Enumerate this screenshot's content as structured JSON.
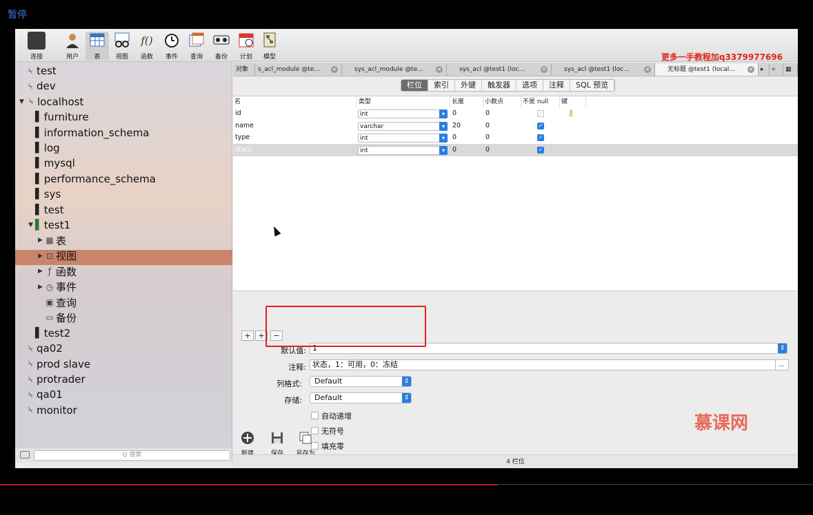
{
  "video": {
    "state_label": "暂停"
  },
  "watermark": {
    "top_right": "更多一手教程加q3379977696",
    "brand": "慕课网"
  },
  "toolbar": {
    "items": [
      {
        "label": "连接",
        "icon": "connection-icon"
      },
      {
        "label": "用户",
        "icon": "user-icon"
      },
      {
        "label": "表",
        "icon": "table-icon"
      },
      {
        "label": "视图",
        "icon": "view-icon"
      },
      {
        "label": "函数",
        "icon": "function-icon"
      },
      {
        "label": "事件",
        "icon": "event-icon"
      },
      {
        "label": "查询",
        "icon": "query-icon"
      },
      {
        "label": "备份",
        "icon": "backup-icon"
      },
      {
        "label": "计划",
        "icon": "schedule-icon"
      },
      {
        "label": "模型",
        "icon": "model-icon"
      }
    ],
    "function_glyph": "f()"
  },
  "sidebar": {
    "items": [
      {
        "label": "test",
        "kind": "connection"
      },
      {
        "label": "dev",
        "kind": "connection"
      },
      {
        "label": "localhost",
        "kind": "connection-open"
      },
      {
        "label": "furniture",
        "kind": "database"
      },
      {
        "label": "information_schema",
        "kind": "database"
      },
      {
        "label": "log",
        "kind": "database"
      },
      {
        "label": "mysql",
        "kind": "database"
      },
      {
        "label": "performance_schema",
        "kind": "database"
      },
      {
        "label": "sys",
        "kind": "database"
      },
      {
        "label": "test",
        "kind": "database"
      },
      {
        "label": "test1",
        "kind": "database-open"
      },
      {
        "label": "表",
        "kind": "child"
      },
      {
        "label": "视图",
        "kind": "child"
      },
      {
        "label": "函数",
        "kind": "child"
      },
      {
        "label": "事件",
        "kind": "child"
      },
      {
        "label": "查询",
        "kind": "child"
      },
      {
        "label": "备份",
        "kind": "child"
      },
      {
        "label": "test2",
        "kind": "database"
      },
      {
        "label": "qa02",
        "kind": "connection"
      },
      {
        "label": "prod slave",
        "kind": "connection"
      },
      {
        "label": "protrader",
        "kind": "connection"
      },
      {
        "label": "qa01",
        "kind": "connection"
      },
      {
        "label": "monitor",
        "kind": "connection"
      }
    ],
    "search_placeholder": "搜索",
    "search_glyph": "Q"
  },
  "tabs": {
    "objects_label": "对象",
    "items": [
      {
        "label": "s_acl_module @te..."
      },
      {
        "label": "sys_acl_module @te..."
      },
      {
        "label": "sys_acl @test1 (loc..."
      },
      {
        "label": "sys_acl @test1 (loc..."
      },
      {
        "label": "无标题 @test1 (local..."
      }
    ]
  },
  "designer": {
    "segments": [
      "栏位",
      "索引",
      "外键",
      "触发器",
      "选项",
      "注释",
      "SQL 预览"
    ],
    "columns_header": [
      "名",
      "类型",
      "长度",
      "小数点",
      "不是 null",
      "键"
    ],
    "rows": [
      {
        "name": "id",
        "type": "int",
        "length": "0",
        "decimals": "0",
        "not_null": true,
        "key": true
      },
      {
        "name": "name",
        "type": "varchar",
        "length": "20",
        "decimals": "0",
        "not_null": true,
        "key": false
      },
      {
        "name": "type",
        "type": "int",
        "length": "0",
        "decimals": "0",
        "not_null": true,
        "key": false
      },
      {
        "name": "statu",
        "type": "int",
        "length": "0",
        "decimals": "0",
        "not_null": true,
        "key": false
      }
    ],
    "row_buttons": [
      "+",
      "+",
      "−"
    ],
    "props": {
      "default_label": "默认值:",
      "default_value": "1",
      "comment_label": "注释:",
      "comment_value": "状态，1：可用，0：冻结",
      "column_format_label": "列格式:",
      "column_format_value": "Default",
      "storage_label": "存储:",
      "storage_value": "Default",
      "auto_increment": "自动递增",
      "unsigned": "无符号",
      "zerofill": "填充零",
      "more_button": "..."
    }
  },
  "bottom_tools": [
    {
      "label": "新建",
      "icon": "new-icon"
    },
    {
      "label": "保存",
      "icon": "save-icon"
    },
    {
      "label": "另存为",
      "icon": "save-as-icon"
    }
  ],
  "status": {
    "text": "4 栏位"
  },
  "colors": {
    "accent": "#2b7de0",
    "selection_sidebar": "#c9856b",
    "highlight_box": "#e02020",
    "progress": "#c31a1a"
  }
}
